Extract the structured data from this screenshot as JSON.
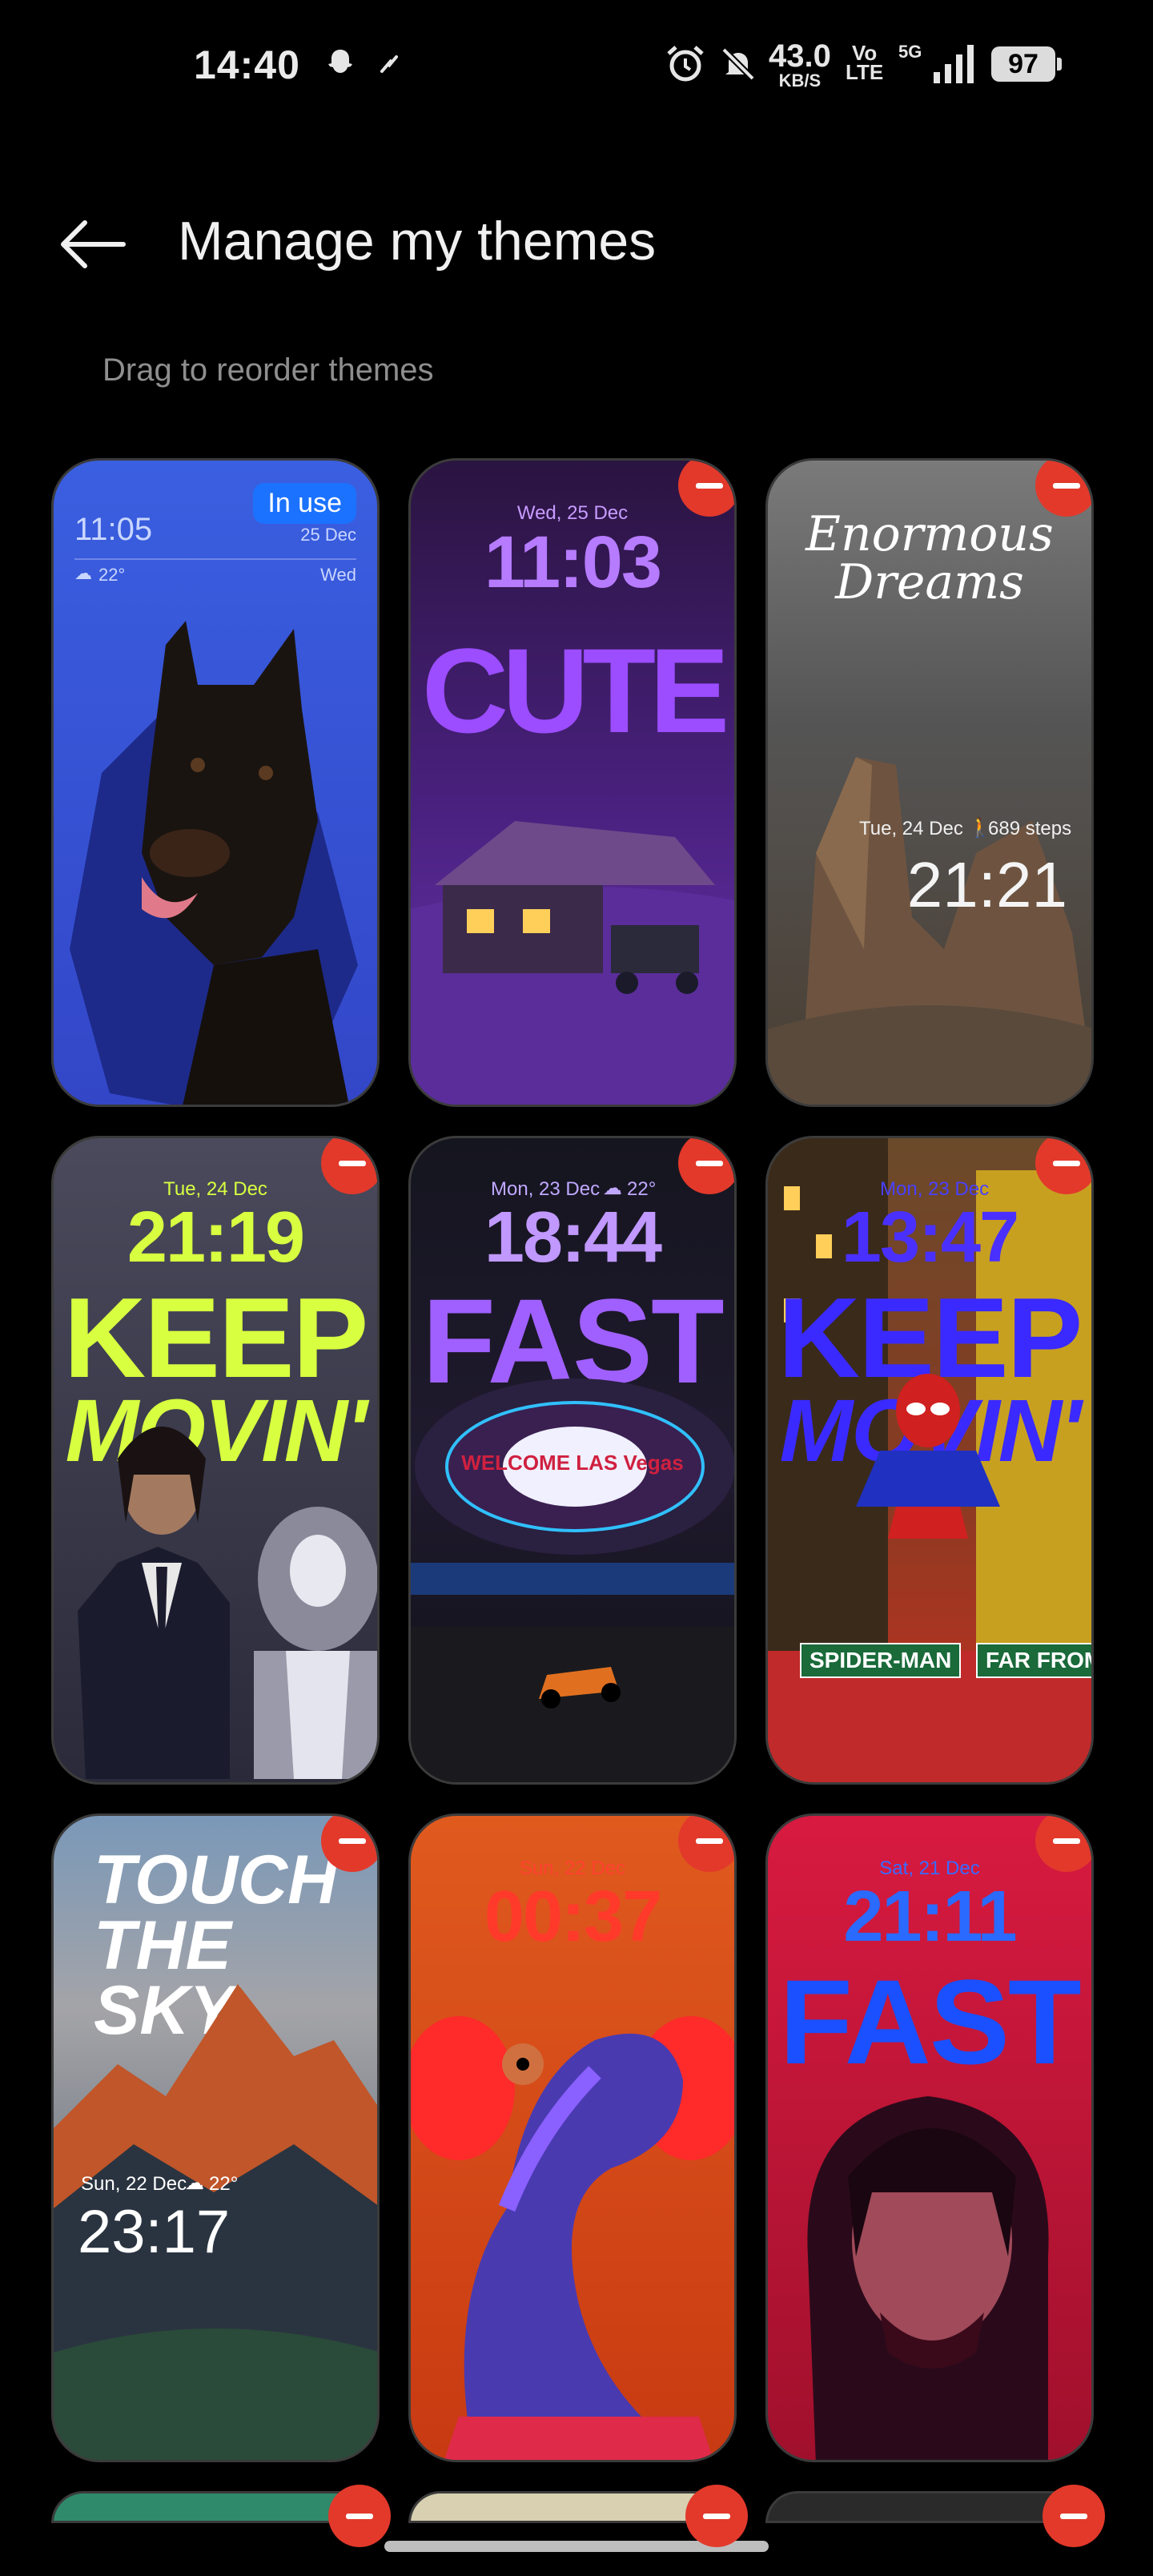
{
  "status_bar": {
    "time": "14:40",
    "net_speed_value": "43.0",
    "net_speed_unit": "KB/S",
    "volte_top": "Vo",
    "volte_bottom": "LTE",
    "network": "5G",
    "battery": "97",
    "icons": [
      "snapchat-icon",
      "notification-icon",
      "alarm-icon",
      "mute-icon",
      "signal-icon"
    ]
  },
  "header": {
    "title": "Manage my themes",
    "back_icon": "arrow-left-icon",
    "subtitle": "Drag to reorder themes"
  },
  "themes": [
    {
      "name": "Doberman",
      "in_use": "In use",
      "time": "11:05",
      "date": "25 Dec",
      "weather": "22°",
      "day": "Wed",
      "colors": [
        "#3152d8",
        "#1a2a7a"
      ]
    },
    {
      "name": "Cute",
      "date": "Wed, 25 Dec",
      "time": "11:03",
      "word": "CUTE",
      "colors": [
        "#3a1a5e",
        "#6a2fb0"
      ]
    },
    {
      "name": "Enormous Dreams",
      "script": "Enormous Dreams",
      "date": "Tue, 24 Dec",
      "steps": "689 steps",
      "time": "21:21",
      "colors": [
        "#5e5e5e",
        "#5a4a3a"
      ]
    },
    {
      "name": "Keep Movin John Wick",
      "date": "Tue, 24 Dec",
      "time": "21:19",
      "word1": "KEEP",
      "word2": "MOVIN'",
      "colors": [
        "#3f3f52",
        "#1e1e2a"
      ]
    },
    {
      "name": "Las Vegas",
      "date": "Mon, 23 Dec",
      "weather": "22°",
      "time": "18:44",
      "word": "FAST",
      "sign": "WELCOME LAS Vegas",
      "colors": [
        "#141420",
        "#2a1a3a"
      ]
    },
    {
      "name": "Keep Movin Spider-Man",
      "date": "Mon, 23 Dec",
      "time": "13:47",
      "word1": "KEEP",
      "word2": "MOVIN'",
      "sign1": "SPIDER-MAN",
      "sign2": "FAR FROM HO",
      "colors": [
        "#6a3a1a",
        "#b03020"
      ]
    },
    {
      "name": "Touch The Sky",
      "script": "TOUCH THE SKY",
      "date": "Sun, 22 Dec",
      "weather": "22°",
      "time": "23:17",
      "colors": [
        "#6e8aa8",
        "#1e2a3a"
      ]
    },
    {
      "name": "Snake",
      "date": "Sun, 22 Dec",
      "time": "00:37",
      "colors": [
        "#d8501a",
        "#a02a10"
      ]
    },
    {
      "name": "Fast John Wick",
      "date": "Sat, 21 Dec",
      "time": "21:11",
      "word": "FAST",
      "colors": [
        "#c01838",
        "#6a0a20"
      ]
    },
    {
      "name": "Partial 1",
      "colors": [
        "#2e8a6a",
        "#2e8a6a"
      ]
    },
    {
      "name": "Partial 2",
      "colors": [
        "#d8d0b0",
        "#d8d0b0"
      ]
    },
    {
      "name": "Partial 3",
      "colors": [
        "#2a2a2a",
        "#2a2a2a"
      ]
    }
  ],
  "accent": "#e2392b"
}
